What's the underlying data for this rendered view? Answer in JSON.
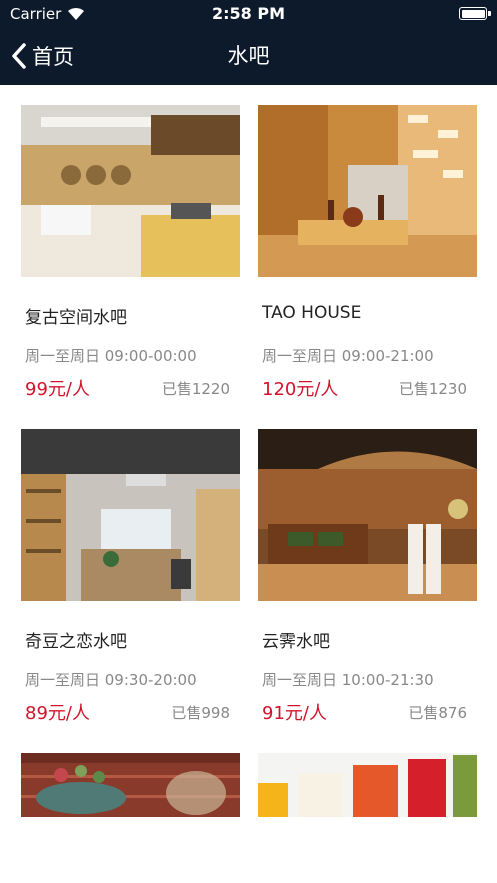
{
  "status_bar": {
    "carrier": "Carrier",
    "time": "2:58 PM"
  },
  "nav": {
    "back_label": "首页",
    "title": "水吧"
  },
  "colors": {
    "nav_bg": "#0d1a2b",
    "price": "#d0142b",
    "muted": "#888888"
  },
  "items": [
    {
      "name": "复古空间水吧",
      "hours": "周一至周日 09:00-00:00",
      "price": "99元/人",
      "sold": "已售1220"
    },
    {
      "name": "TAO HOUSE",
      "hours": "周一至周日 09:00-21:00",
      "price": "120元/人",
      "sold": "已售1230"
    },
    {
      "name": "奇豆之恋水吧",
      "hours": "周一至周日 09:30-20:00",
      "price": "89元/人",
      "sold": "已售998"
    },
    {
      "name": "云霁水吧",
      "hours": "周一至周日 10:00-21:30",
      "price": "91元/人",
      "sold": "已售876"
    },
    {
      "name": "",
      "hours": "",
      "price": "",
      "sold": ""
    },
    {
      "name": "",
      "hours": "",
      "price": "",
      "sold": ""
    }
  ]
}
